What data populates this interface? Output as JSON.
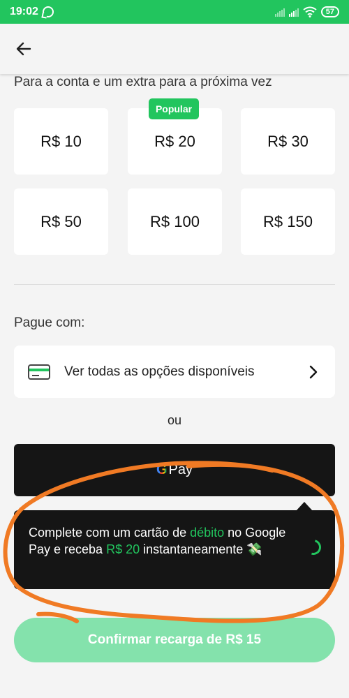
{
  "status_bar": {
    "time": "19:02",
    "battery": "57"
  },
  "header": {
    "back_label": "back"
  },
  "subtitle": "Para a conta e um extra para a próxima vez",
  "popular_badge": "Popular",
  "amounts": [
    "R$ 10",
    "R$ 20",
    "R$ 30",
    "R$ 50",
    "R$ 100",
    "R$ 150"
  ],
  "payment": {
    "section_label": "Pague com:",
    "all_options_label": "Ver todas as opções disponíveis",
    "or_label": "ou",
    "gpay_g": "G",
    "gpay_label": "Pay"
  },
  "tooltip": {
    "part1": "Complete com um cartão de ",
    "highlight1": "débito",
    "part2": " no Google Pay e receba ",
    "highlight2": "R$ 20",
    "part3": " instantaneamente ",
    "emoji": "💸"
  },
  "confirm_button": "Confirmar recarga de R$ 15",
  "colors": {
    "brand_green": "#22c55e",
    "confirm_disabled": "#84e2ac",
    "dark_surface": "#151515",
    "annotation_orange": "#f07a24"
  }
}
